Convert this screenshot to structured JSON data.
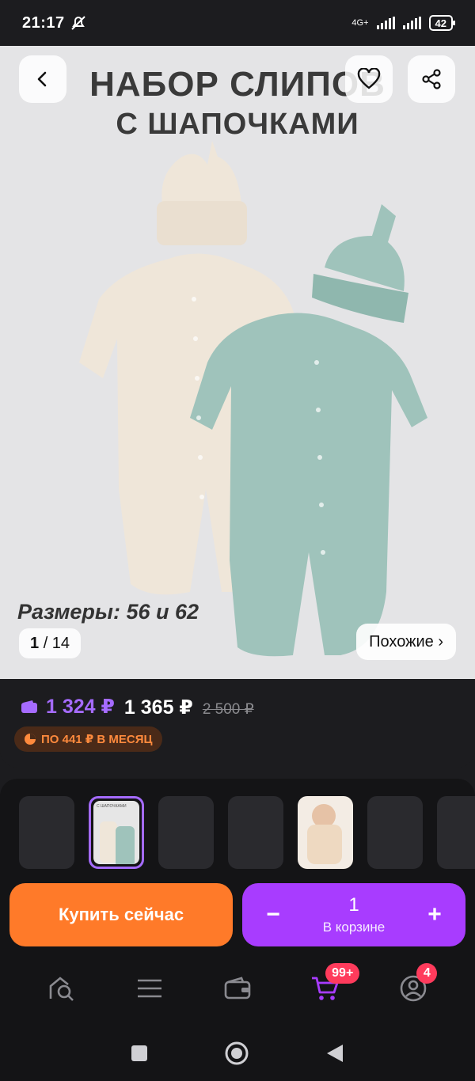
{
  "status_bar": {
    "time": "21:17",
    "network": "4G+",
    "battery": "42"
  },
  "hero": {
    "title_line1": "НАБОР СЛИПОВ",
    "title_line2": "С ШАПОЧКАМИ",
    "sizes_caption": "Размеры: 56 и 62",
    "counter_current": "1",
    "counter_total": "/ 14",
    "similar_label": "Похожие ›"
  },
  "price": {
    "wallet_price": "1 324 ₽",
    "regular_price": "1 365 ₽",
    "old_price": "2 500 ₽",
    "installment": "ПО 441 ₽ В МЕСЯЦ"
  },
  "thumbs_label": "С ШАПОЧКАМИ",
  "actions": {
    "buy_now": "Купить сейчас",
    "cart_qty": "1",
    "cart_label": "В корзине",
    "minus": "−",
    "plus": "+"
  },
  "tabs": [
    {
      "name": "catalog"
    },
    {
      "name": "menu"
    },
    {
      "name": "wallet"
    },
    {
      "name": "cart",
      "badge": "99+"
    },
    {
      "name": "profile",
      "badge": "4"
    }
  ],
  "icons": [
    "back-arrow-icon",
    "heart-icon",
    "share-icon",
    "wallet-icon",
    "installment-icon",
    "search-home-icon",
    "menu-icon",
    "wallet-tab-icon",
    "cart-icon",
    "profile-icon"
  ],
  "colors": {
    "accent_purple": "#a83cff",
    "accent_orange": "#ff7a29",
    "badge_red": "#ff3b5c",
    "mint": "#9fc3bb",
    "cream": "#efe6d9"
  }
}
